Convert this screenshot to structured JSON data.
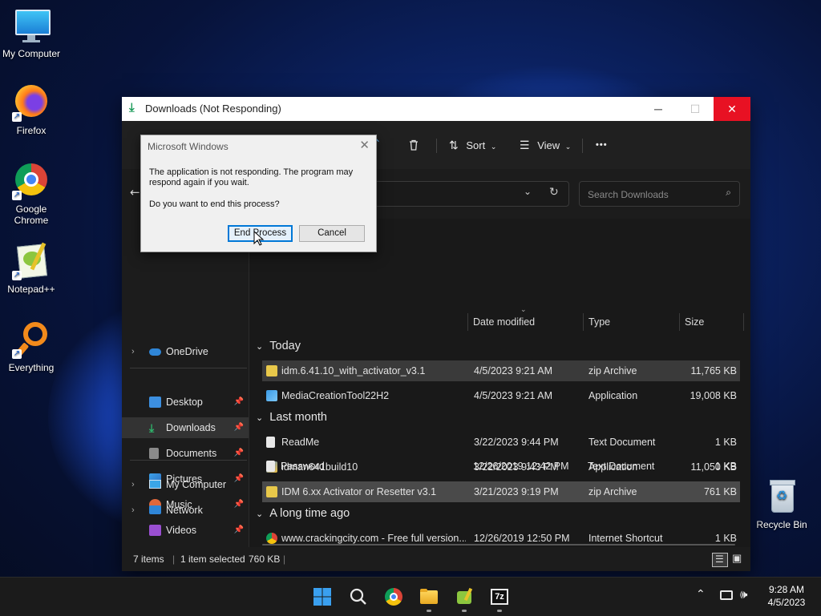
{
  "desktop": {
    "icons": [
      {
        "label": "My Computer",
        "icon": "monitor-icon"
      },
      {
        "label": "Firefox",
        "icon": "firefox-icon"
      },
      {
        "label": "Google Chrome",
        "icon": "chrome-icon"
      },
      {
        "label": "Notepad++",
        "icon": "notepad-plus-plus-icon"
      },
      {
        "label": "Everything",
        "icon": "everything-search-icon"
      },
      {
        "label": "Recycle Bin",
        "icon": "recycle-bin-icon"
      }
    ]
  },
  "window": {
    "title": "Downloads (Not Responding)",
    "minimize": "─",
    "maximize": "☐",
    "close": "✕"
  },
  "toolbar": {
    "sort_label": "Sort",
    "view_label": "View",
    "more_label": "•••"
  },
  "address": {
    "search_placeholder": "Search Downloads"
  },
  "nav": {
    "onedrive": "OneDrive",
    "quick": [
      {
        "label": "Desktop",
        "icon": "desktop-folder-icon",
        "color": "#3c8fe0"
      },
      {
        "label": "Downloads",
        "icon": "downloads-icon",
        "color": "#2fb36b"
      },
      {
        "label": "Documents",
        "icon": "documents-icon",
        "color": "#8a8a8a"
      },
      {
        "label": "Pictures",
        "icon": "pictures-icon",
        "color": "#3ca0e8"
      },
      {
        "label": "Music",
        "icon": "music-icon",
        "color": "#e0683c"
      },
      {
        "label": "Videos",
        "icon": "videos-icon",
        "color": "#9a4fd1"
      }
    ],
    "my_computer": "My Computer",
    "network": "Network"
  },
  "columns": {
    "date": "Date modified",
    "type": "Type",
    "size": "Size"
  },
  "groups": {
    "today": "Today",
    "last_month": "Last month",
    "long_ago": "A long time ago"
  },
  "files": {
    "today": [
      {
        "name": "idm.6.41.10_with_activator_v3.1",
        "date": "4/5/2023 9:21 AM",
        "type": "zip Archive",
        "size": "11,765 KB"
      },
      {
        "name": "MediaCreationTool22H2",
        "date": "4/5/2023 9:21 AM",
        "type": "Application",
        "size": "19,008 KB"
      }
    ],
    "last_month": [
      {
        "name": "ReadMe",
        "date": "3/22/2023 9:44 PM",
        "type": "Text Document",
        "size": "1 KB"
      },
      {
        "name": "idman641build10",
        "date": "3/22/2023 9:43 PM",
        "type": "Application",
        "size": "11,050 KB"
      },
      {
        "name": "IDM 6.xx Activator or Resetter v3.1",
        "date": "3/21/2023 9:19 PM",
        "type": "zip Archive",
        "size": "761 KB"
      }
    ],
    "long_ago": [
      {
        "name": "www.crackingcity.com - Free full version...",
        "date": "12/26/2019 12:50 PM",
        "type": "Internet Shortcut",
        "size": "1 KB"
      },
      {
        "name": "Password",
        "date": "12/26/2019 12:42 PM",
        "type": "Text Document",
        "size": "1 KB"
      }
    ]
  },
  "status": {
    "items": "7 items",
    "selected": "1 item selected",
    "size": "760 KB"
  },
  "dialog": {
    "title": "Microsoft Windows",
    "message": "The application is not responding. The program may respond again if you wait.",
    "question": "Do you want to end this process?",
    "end_button": "End Process",
    "cancel_button": "Cancel"
  },
  "taskbar": {
    "time": "9:28 AM",
    "date": "4/5/2023"
  }
}
